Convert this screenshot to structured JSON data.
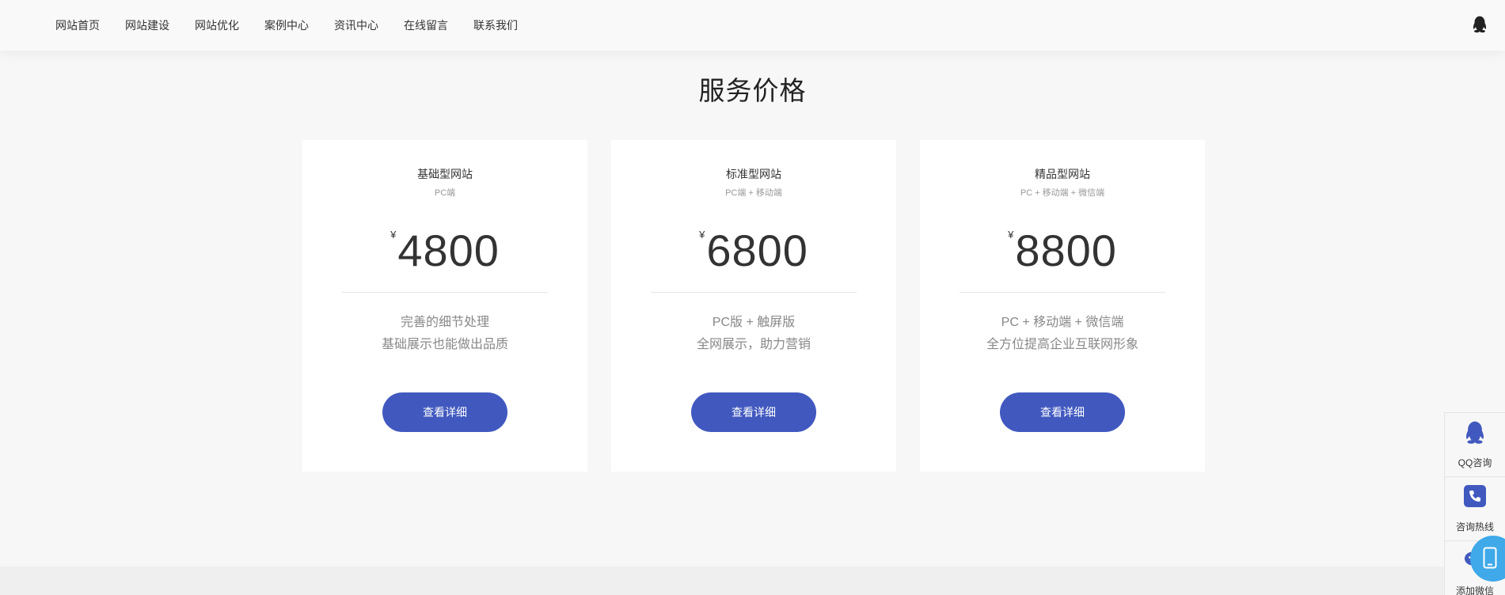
{
  "nav": {
    "items": [
      "网站首页",
      "网站建设",
      "网站优化",
      "案例中心",
      "资讯中心",
      "在线留言",
      "联系我们"
    ]
  },
  "section": {
    "title": "服务价格"
  },
  "cards": [
    {
      "name": "基础型网站",
      "sub": "PC端",
      "currency": "¥",
      "price": "4800",
      "line1": "完善的细节处理",
      "line2": "基础展示也能做出品质",
      "button": "查看详细"
    },
    {
      "name": "标准型网站",
      "sub": "PC端 + 移动端",
      "currency": "¥",
      "price": "6800",
      "line1": "PC版 + 触屏版",
      "line2": "全网展示，助力营销",
      "button": "查看详细"
    },
    {
      "name": "精品型网站",
      "sub": "PC + 移动端 + 微信端",
      "currency": "¥",
      "price": "8800",
      "line1": "PC + 移动端 + 微信端",
      "line2": "全方位提高企业互联网形象",
      "button": "查看详细"
    }
  ],
  "sidebar": {
    "items": [
      {
        "label": "QQ咨询",
        "icon": "qq-icon"
      },
      {
        "label": "咨询热线",
        "icon": "phone-icon"
      },
      {
        "label": "添加微信",
        "icon": "wechat-icon"
      }
    ]
  },
  "colors": {
    "accent": "#4159bf",
    "mobile_button": "#3fa9e9",
    "background": "#f7f7f7"
  }
}
